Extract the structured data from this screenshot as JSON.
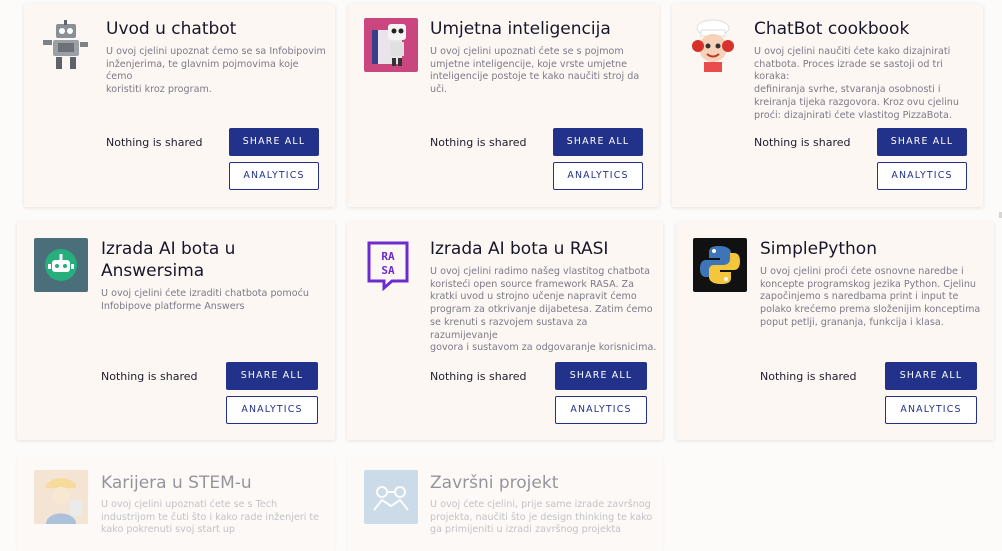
{
  "shared_label": "Nothing is shared",
  "share_all_label": "SHARE ALL",
  "analytics_label": "ANALYTICS",
  "colors": {
    "primary": "#22328a",
    "card_bg": "#fdf7f4"
  },
  "cards": [
    {
      "title": "Uvod u chatbot",
      "icon": "robot-icon",
      "lines": [
        "U ovoj cjelini upoznat ćemo se sa Infobipovim",
        "inženjerima, te glavnim pojmovima koje ćemo",
        "koristiti kroz program."
      ]
    },
    {
      "title": "Umjetna inteligencija",
      "icon": "ai-book-icon",
      "lines": [
        "U ovoj cjelini upoznati ćete se s pojmom",
        "umjetne inteligencije, koje vrste umjetne",
        "inteligencije postoje te kako naučiti stroj da uči."
      ]
    },
    {
      "title": "ChatBot cookbook",
      "icon": "chef-icon",
      "lines": [
        "U ovoj cjelini naučiti ćete kako dizajnirati",
        "chatbota. Proces izrade se sastoji od tri koraka:",
        "definiranja svrhe, stvaranja osobnosti i",
        "kreiranja tijeka razgovora. Kroz ovu cjelinu",
        "proći: dizajnirati ćete vlastitog PizzaBota."
      ]
    },
    {
      "title_lines": [
        "Izrada AI bota u",
        "Answersima"
      ],
      "icon": "bot-head-icon",
      "lines": [
        "U ovoj cjelini ćete izraditi chatbota pomoću",
        "Infobipove platforme Answers"
      ]
    },
    {
      "title": "Izrada AI bota u RASI",
      "icon": "rasa-logo-icon",
      "logo_text": "RASA",
      "lines": [
        "U ovoj cjelini radimo našeg vlastitog chatbota",
        "koristeći open source framework RASA. Za",
        "kratki uvod u strojno učenje napravit ćemo",
        "program za otkrivanje dijabetesa. Zatim ćemo",
        "se krenuti s razvojem sustava za razumijevanje",
        "govora i sustavom za odgovaranje korisnicima."
      ]
    },
    {
      "title": "SimplePython",
      "icon": "python-logo-icon",
      "lines": [
        "U ovoj cjelini proći ćete osnovne naredbe i",
        "koncepte programskog jezika Python. Cjelinu",
        "započinjemo s naredbama print i input te",
        "polako krećemo prema složenijim konceptima",
        "poput petlji, grananja, funkcija i klasa."
      ]
    },
    {
      "title": "Karijera u STEM-u",
      "icon": "engineer-icon",
      "lines": [
        "U ovoj cjelini upoznati ćete se s Tech",
        "industrijom te čuti što i kako rade inženjeri te",
        "kako pokrenuti svoj start up"
      ]
    },
    {
      "title": "Završni projekt",
      "icon": "project-sketch-icon",
      "lines": [
        "U ovoj ćete cjelini, prije same izrade završnog",
        "projekta, naučiti što je design thinking te kako",
        "ga primijeniti u izradi završnog projekta"
      ]
    }
  ]
}
